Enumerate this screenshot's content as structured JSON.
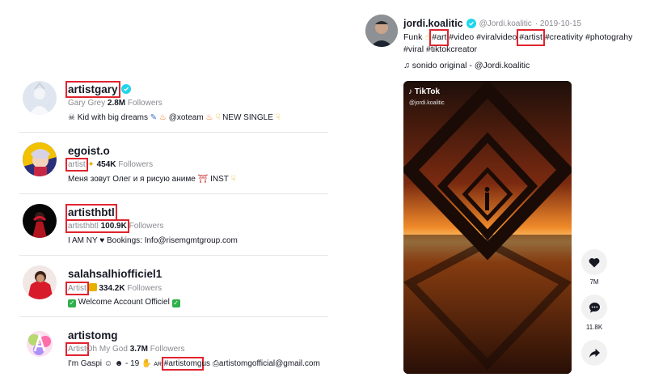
{
  "accounts": [
    {
      "name": "artistgary",
      "verified": true,
      "label": "Gary Grey",
      "followers_count": "2.8M",
      "followers_text": "Followers",
      "bio_parts": [
        "Kid with big dreams",
        "@xoteam",
        "NEW SINGLE"
      ]
    },
    {
      "name": "egoist.o",
      "verified": false,
      "label": "artist",
      "followers_count": "454K",
      "followers_text": "Followers",
      "bio_parts": [
        "Меня зовут Олег и я рисую аниме",
        "INST"
      ]
    },
    {
      "name": "artisthbtl",
      "verified": false,
      "label": "artisthbtl",
      "followers_count": "100.9K",
      "followers_text": "Followers",
      "bio_parts": [
        "I AM NY",
        "Bookings: Info@risemgmtgroup.com"
      ]
    },
    {
      "name": "salahsalhiofficiel1",
      "verified": false,
      "label": "Artist",
      "followers_count": "334.2K",
      "followers_text": "Followers",
      "bio_parts": [
        "Welcome Account Officiel"
      ]
    },
    {
      "name": "artistomg",
      "verified": false,
      "label": "Artist",
      "label_rest": "Oh My God",
      "followers_count": "3.7M",
      "followers_text": "Followers",
      "bio_parts": [
        "I'm Gaspi",
        "- 19",
        "AR",
        "#artistomg",
        "us",
        "artistomgofficial@gmail.com"
      ]
    }
  ],
  "post": {
    "author": "jordi.koalitic",
    "handle": "@Jordi.koalitic",
    "date": "· 2019-10-15",
    "caption_prefix": "Funk",
    "tags": [
      "#art",
      "#video",
      "#viralvideo",
      "#artist",
      "#creativity",
      "#photograhy",
      "#viral",
      "#tiktokcreator"
    ],
    "sound": "sonido original - @Jordi.koalitic",
    "video_logo": "TikTok",
    "video_handle": "@jordi.koalitic",
    "likes": "7M",
    "comments": "11.8K"
  },
  "colors": {
    "highlight": "#e0242e",
    "verified": "#20d5ec",
    "muted_text": "#8a8b91"
  }
}
